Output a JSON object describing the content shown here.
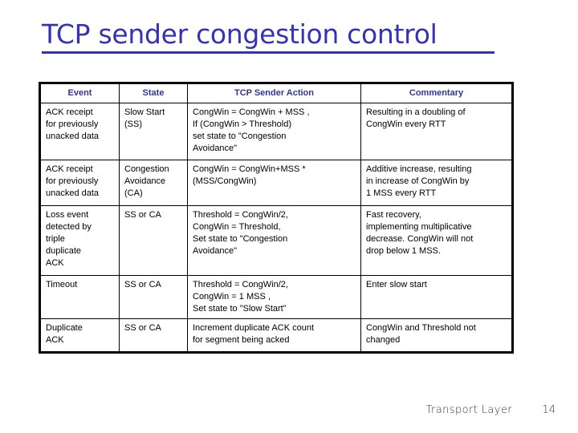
{
  "slide": {
    "title": "TCP sender congestion control",
    "title_color": "#3333b3"
  },
  "table": {
    "header_color": "#333399",
    "columns": [
      "Event",
      "State",
      "TCP Sender Action",
      "Commentary"
    ],
    "rows": [
      {
        "event": "ACK receipt\nfor previously\nunacked data",
        "state": "Slow Start\n(SS)",
        "action": "CongWin = CongWin + MSS ,\nIf (CongWin > Threshold)\n     set state to \"Congestion\nAvoidance\"",
        "commentary": "Resulting in a doubling of\nCongWin every RTT"
      },
      {
        "event": "ACK receipt\nfor previously\nunacked data",
        "state": "Congestion\nAvoidance\n(CA)",
        "action": "CongWin = CongWin+MSS *\n(MSS/CongWin)",
        "commentary": "Additive increase, resulting\nin increase of CongWin  by\n1 MSS every RTT"
      },
      {
        "event": "Loss event\ndetected by\ntriple\nduplicate\nACK",
        "state": "SS or CA",
        "action": "Threshold = CongWin/2,\nCongWin = Threshold,\nSet state to \"Congestion\nAvoidance\"",
        "commentary": "Fast recovery,\nimplementing multiplicative\ndecrease. CongWin will not\ndrop below 1 MSS."
      },
      {
        "event": "Timeout",
        "state": "SS or CA",
        "action": "Threshold = CongWin/2,\nCongWin = 1 MSS ,\nSet state to \"Slow Start\"",
        "commentary": "Enter slow start"
      },
      {
        "event": "Duplicate\nACK",
        "state": "SS or CA",
        "action": "Increment duplicate ACK count\nfor segment being acked",
        "commentary": "CongWin and Threshold not\nchanged"
      }
    ]
  },
  "footer": {
    "label": "Transport Layer",
    "page": "14"
  }
}
